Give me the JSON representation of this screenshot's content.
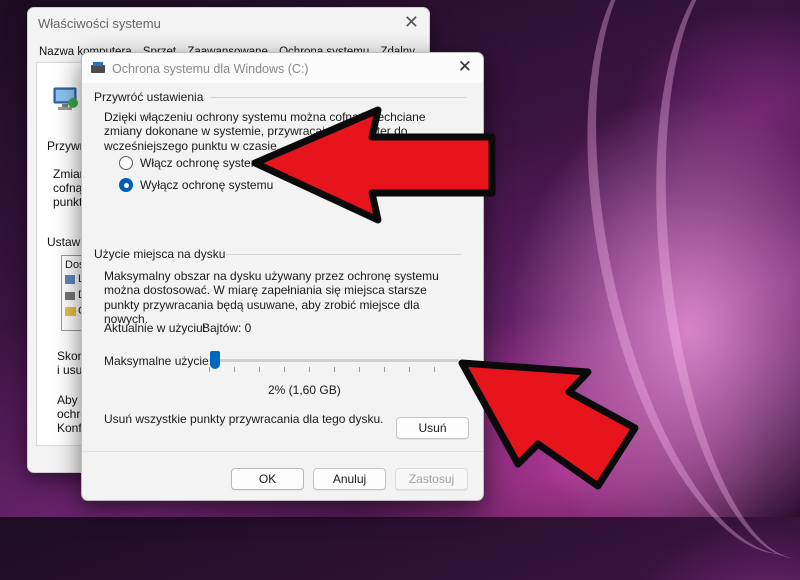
{
  "background": {
    "accent": "#6d2470"
  },
  "back_window": {
    "title": "Właściwości systemu",
    "tabs": [
      "Nazwa komputera",
      "Sprzęt",
      "Zaawansowane",
      "Ochrona systemu",
      "Zdalny"
    ],
    "label_przywr": "Przywr",
    "label_zmiany": [
      "Zmiany",
      "cofnąć",
      "punktu"
    ],
    "label_ustawie": "Ustawie",
    "list_items": [
      "Dos",
      "L",
      "D",
      "C"
    ],
    "label_skon": [
      "Skon",
      "i usuv"
    ],
    "label_aby": [
      "Aby u",
      "ochro",
      "Konfi"
    ]
  },
  "dialog": {
    "title": "Ochrona systemu dla Windows (C:)",
    "restore_group": "Przywróć ustawienia",
    "restore_desc": "Dzięki włączeniu ochrony systemu można cofnąć niechciane zmiany dokonane w systemie, przywracając komputer do wcześniejszego punktu w czasie.",
    "options": {
      "enable": "Włącz ochronę systemu",
      "disable": "Wyłącz ochronę systemu",
      "selected": "disable"
    },
    "disk_group": "Użycie miejsca na dysku",
    "disk_desc": "Maksymalny obszar na dysku używany przez ochronę systemu można dostosować. W miarę zapełniania się miejsca starsze punkty przywracania będą usuwane, aby zrobić miejsce dla nowych.",
    "current_usage_label": "Aktualnie w użyciu:",
    "current_usage_value": "Bajtów: 0",
    "max_usage_label": "Maksymalne użycie:",
    "max_usage_percent": 2,
    "max_usage_text": "2% (1,60 GB)",
    "delete_desc": "Usuń wszystkie punkty przywracania dla tego dysku.",
    "delete_button": "Usuń",
    "ok_button": "OK",
    "cancel_button": "Anuluj",
    "apply_button": "Zastosuj"
  },
  "annotations": {
    "arrow_color": "#e8141c",
    "arrow_outline": "#0a0a0a"
  }
}
